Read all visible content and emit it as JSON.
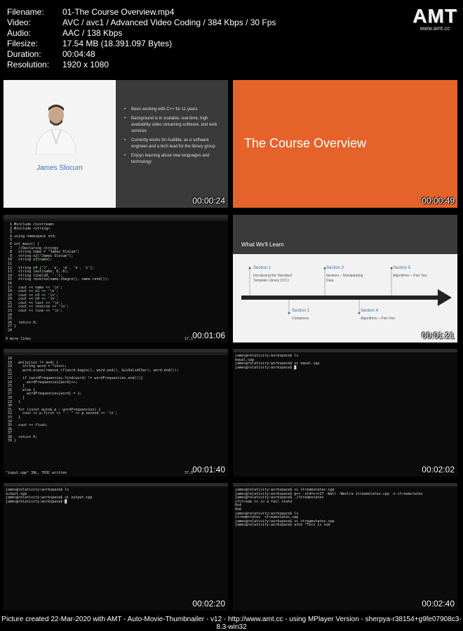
{
  "info": [
    {
      "key": "Filename:",
      "value": "01-The Course Overview.mp4"
    },
    {
      "key": "Video:",
      "value": "AVC / avc1 / Advanced Video Coding / 384 Kbps / 30 Fps"
    },
    {
      "key": "Audio:",
      "value": "AAC / 138 Kbps"
    },
    {
      "key": "Filesize:",
      "value": "17.54 MB (18.391.097 Bytes)"
    },
    {
      "key": "Duration:",
      "value": "00:04:48"
    },
    {
      "key": "Resolution:",
      "value": "1920 x 1080"
    }
  ],
  "logo": {
    "big": "AMT",
    "small": "www.amt.cc"
  },
  "thumbs": {
    "t1": {
      "timestamp": "00:00:24",
      "name": "James Slocum",
      "bullets": [
        "Been working with C++ for 11 years",
        "Background is in scalable, real-time, high availability video streaming software, and web services",
        "Currently works for Audible, as a software engineer and a tech lead for the library group",
        "Enjoys learning about new languages and technology"
      ]
    },
    "t2": {
      "timestamp": "00:00:49",
      "title": "The Course Overview"
    },
    "t3": {
      "timestamp": "00:01:06",
      "code": "  1 #include <iostream>\n  2 #include <string>\n  3\n  4 using namespace std;\n  5\n  6 int main() {\n  7   //Declaring strings\n  8   string name = \"James Slocum\";\n  9   string n2(\"James Slocum\");\n 10   string n3(name);\n 11\n 12   string n4 {'J', 'a', 'm', 'e', 's'};\n 13   string last(name, 6, 6);\n 14   string line(20, '-');\n 15   string reverse(name.rbegin(), name.rend());\n 16\n 17   cout << name << '\\n';\n 18   cout << n2 << '\\n';\n 19   cout << n3 << '\\n';\n 20   cout << n4 << '\\n';\n 21   cout << last << '\\n';\n 22   cout << reverse << '\\n';\n 23   cout << line << '\\n';\n 24\n 25\n 26   return 0;\n 27 }\n 28",
      "status": "9 more lines",
      "pos": "17,1"
    },
    "t4": {
      "timestamp": "00:01:21",
      "header": "What We'll Learn",
      "sections_top": [
        {
          "title": "Section 1",
          "desc": "Introducing the Standard Template Library (STL)"
        },
        {
          "title": "Section 3",
          "desc": "Iterators – Manipulating Data"
        },
        {
          "title": "Section 5",
          "desc": "Algorithms – Part Two"
        }
      ],
      "sections_bottom": [
        {
          "title": "Section 2",
          "desc": "Containers"
        },
        {
          "title": "Section 4",
          "desc": "Algorithms – Part One"
        }
      ]
    },
    "t5": {
      "timestamp": "00:01:40",
      "code": " 18\n 19   while(ins != end) {\n 20     string word = *ins++;\n 21     word.erase(remove_if(word.begin(), word.end(), &isValidChar), word.end());\n 22\n 23     if (wordFrequencies.find(word) != wordFrequencies.end()){\n 24       wordFrequencies[word]++;\n 25     }\n 26     else {\n 27       wordFrequencies[word] = 1;\n 28     }\n 29   }\n 30\n 31   for (const auto& p : wordFrequencies) {\n 32     cout << p.first << \" : \" << p.second << '\\n';\n 33   }\n 34\n 35   cout << flush;\n 36\n 37\n 38   return 0;\n 39 }",
      "status": "\"input.cpp\" 39L, 703C written",
      "pos": "37,0"
    },
    "t6": {
      "timestamp": "00:02:02",
      "lines": [
        "james@relativity:workspace$ ls",
        "equal.cpp",
        "james@relativity:workspace$ vi equal.cpp",
        "james@relativity:workspace$ █"
      ]
    },
    "t7": {
      "timestamp": "00:02:20",
      "lines": [
        "james@relativity:workspace$ ls",
        "output.cpp",
        "james@relativity:workspace$ vi output.cpp",
        "james@relativity:workspace$ █"
      ]
    },
    "t8": {
      "timestamp": "00:02:40",
      "lines": [
        "james@relativity:workspace$ vi streamstates.cpp",
        "james@relativity:workspace$ g++ -std=c++17 -Wall -Wextra streamstates.cpp -o streamstates",
        "james@relativity:workspace$ ./streamstates",
        "ifstream is in a fail state",
        "0x4",
        "0x6",
        "james@relativity:workspace$ ls",
        "streamstates  streamstates.cpp",
        "james@relativity:workspace$ vi streamstates.cpp",
        "james@relativity:workspace$ echo \"This is som"
      ]
    }
  },
  "footer": "Picture created 22-Mar-2020 with AMT - Auto-Movie-Thumbnailer - v12 - http://www.amt.cc - using MPlayer Version - sherpya-r38154+g9fe07908c3-8.3-win32"
}
